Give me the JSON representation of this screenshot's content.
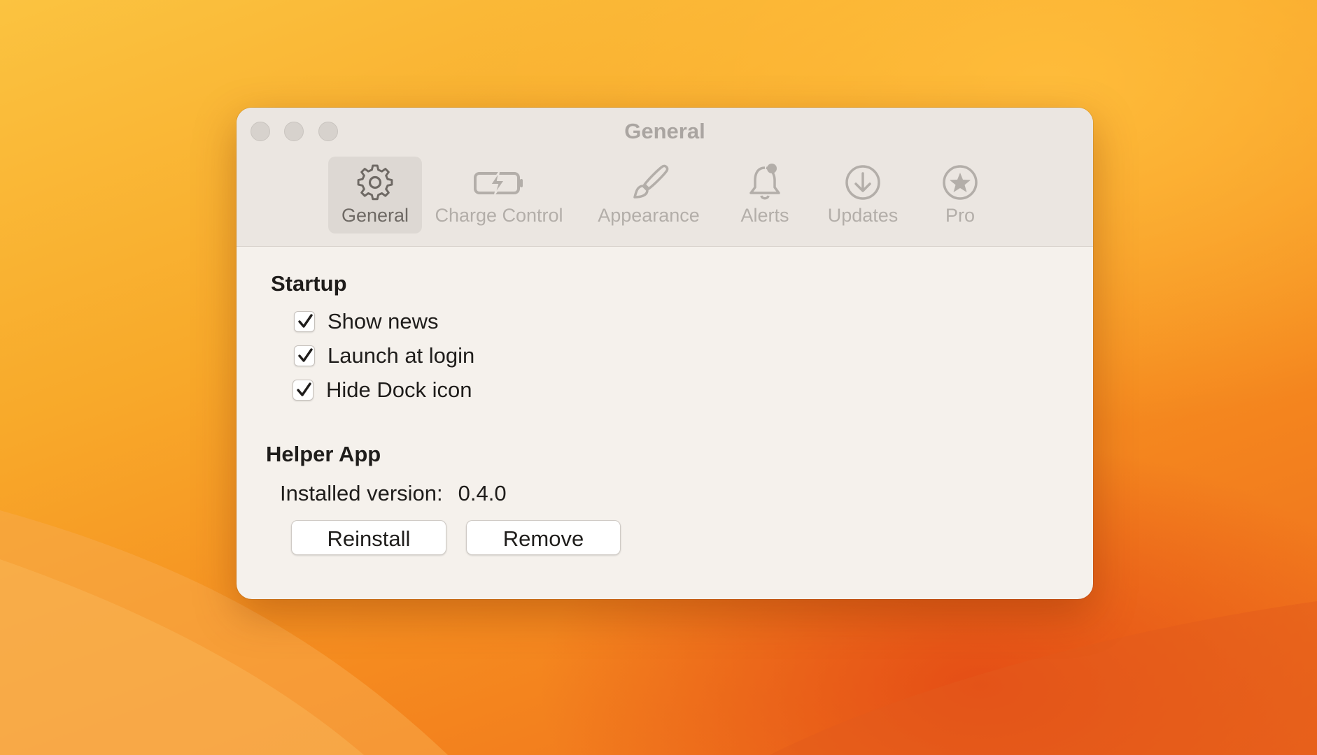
{
  "window": {
    "title": "General"
  },
  "toolbar": {
    "tabs": [
      {
        "label": "General",
        "icon": "gear-icon",
        "selected": true
      },
      {
        "label": "Charge Control",
        "icon": "battery-charging-icon",
        "selected": false
      },
      {
        "label": "Appearance",
        "icon": "paintbrush-icon",
        "selected": false
      },
      {
        "label": "Alerts",
        "icon": "bell-badge-icon",
        "selected": false
      },
      {
        "label": "Updates",
        "icon": "download-arrow-icon",
        "selected": false
      },
      {
        "label": "Pro",
        "icon": "star-circle-icon",
        "selected": false
      }
    ]
  },
  "startup": {
    "title": "Startup",
    "options": [
      {
        "label": "Show news",
        "checked": true
      },
      {
        "label": "Launch at login",
        "checked": true
      },
      {
        "label": "Hide Dock icon",
        "checked": true
      }
    ]
  },
  "helper": {
    "title": "Helper App",
    "version_label": "Installed version:",
    "version_value": "0.4.0",
    "reinstall_label": "Reinstall",
    "remove_label": "Remove"
  },
  "colors": {
    "window_bg": "#f5f1ec",
    "toolbar_bg": "#ebe6e1",
    "selected_tab_bg": "#ddd8d3",
    "wallpaper_orange": "#f58a1f"
  }
}
